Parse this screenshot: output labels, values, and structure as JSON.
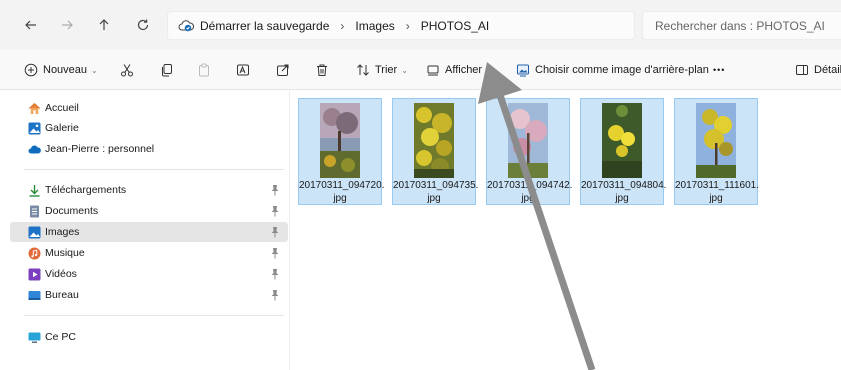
{
  "address_bar": {
    "breadcrumbs": [
      "Démarrer la sauvegarde",
      "Images",
      "PHOTOS_AI"
    ],
    "separator": "›",
    "search_placeholder": "Rechercher dans : PHOTOS_AI"
  },
  "toolbar": {
    "new_label": "Nouveau",
    "sort_label": "Trier",
    "view_label": "Afficher",
    "wallpaper_label": "Choisir comme image d'arrière-plan",
    "more_label": "•••",
    "details_label": "Détails"
  },
  "sidebar": {
    "items": [
      {
        "label": "Accueil",
        "icon": "home-icon"
      },
      {
        "label": "Galerie",
        "icon": "gallery-icon"
      },
      {
        "label": "Jean-Pierre : personnel",
        "icon": "onedrive-cloud-icon"
      },
      {
        "label": "Téléchargements",
        "icon": "download-icon",
        "pinned": true
      },
      {
        "label": "Documents",
        "icon": "documents-icon",
        "pinned": true
      },
      {
        "label": "Images",
        "icon": "pictures-icon",
        "pinned": true,
        "selected": true
      },
      {
        "label": "Musique",
        "icon": "music-icon",
        "pinned": true
      },
      {
        "label": "Vidéos",
        "icon": "videos-icon",
        "pinned": true
      },
      {
        "label": "Bureau",
        "icon": "desktop-icon",
        "pinned": true
      },
      {
        "label": "Ce PC",
        "icon": "this-pc-icon"
      }
    ]
  },
  "files": [
    {
      "line1": "20170311_094720.",
      "line2": "jpg"
    },
    {
      "line1": "20170311_094735.",
      "line2": "jpg"
    },
    {
      "line1": "20170311_094742.",
      "line2": "jpg"
    },
    {
      "line1": "20170311_094804.",
      "line2": "jpg"
    },
    {
      "line1": "20170311_111601.",
      "line2": "jpg"
    }
  ],
  "colors": {
    "selection_fill": "#cce4f7",
    "selection_border": "#99c9ef",
    "annotation_arrow": "#8c8c8c"
  }
}
